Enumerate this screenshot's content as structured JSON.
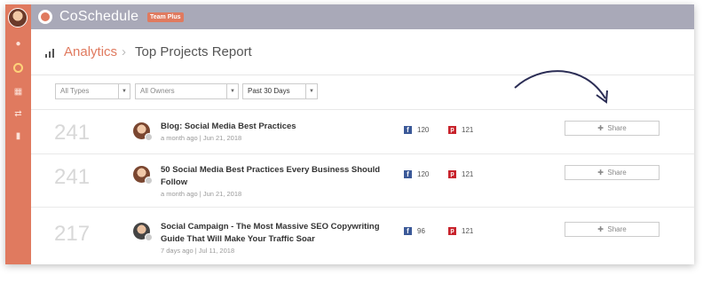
{
  "app": {
    "brand": "CoSchedule",
    "badge": "Team Plus"
  },
  "breadcrumb": {
    "section": "Analytics",
    "separator": "›",
    "page": "Top Projects Report"
  },
  "filters": {
    "type": "All Types",
    "owner": "All Owners",
    "range": "Past 30 Days"
  },
  "share_label": "Share",
  "rows": [
    {
      "rank": "241",
      "title_line1": "Blog: Social Media Best Practices",
      "title_line2": "",
      "meta": "a month ago | Jun 21, 2018",
      "facebook": "120",
      "pinterest": "121"
    },
    {
      "rank": "241",
      "title_line1": "50 Social Media Best Practices Every Business Should",
      "title_line2": "Follow",
      "meta": "a month ago | Jun 21, 2018",
      "facebook": "120",
      "pinterest": "121"
    },
    {
      "rank": "217",
      "title_line1": "Social Campaign - The Most Massive SEO Copywriting",
      "title_line2": "Guide That Will Make Your Traffic Soar",
      "meta": "7 days ago | Jul 11, 2018",
      "facebook": "96",
      "pinterest": "121"
    }
  ],
  "colors": {
    "accent": "#e07a5f",
    "topbar": "#a9a9b8",
    "facebook": "#3b5998",
    "pinterest": "#c8232c"
  }
}
